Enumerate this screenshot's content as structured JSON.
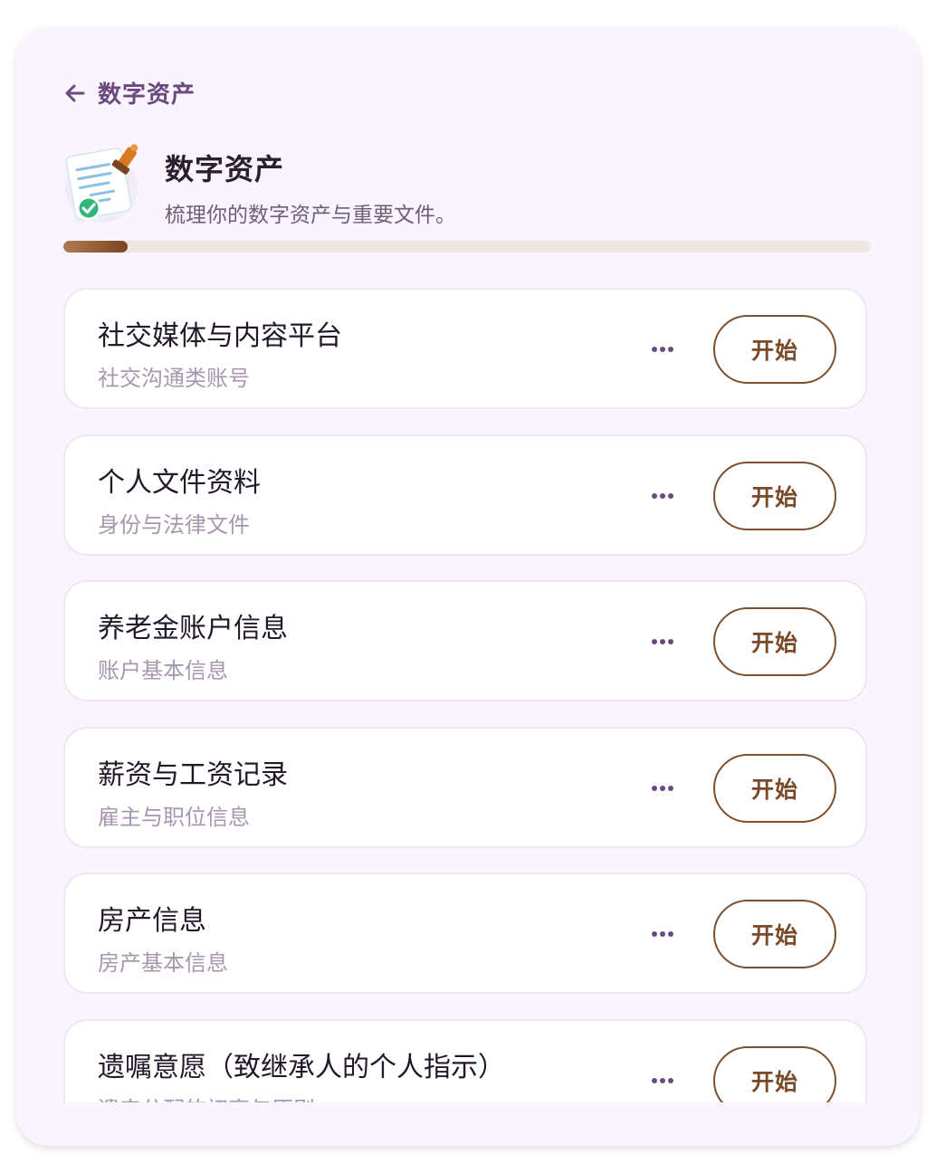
{
  "nav": {
    "back_label": "数字资产"
  },
  "header": {
    "title": "数字资产",
    "subtitle": "梳理你的数字资产与重要文件。"
  },
  "progress": {
    "fraction": 0.08
  },
  "colors": {
    "accent_brown": "#7e4f2f",
    "card_bg": "#f9f4fd",
    "title_purple": "#6a4a7d"
  },
  "items": [
    {
      "title": "社交媒体与内容平台",
      "subtitle": "社交沟通类账号",
      "action": "开始"
    },
    {
      "title": "个人文件资料",
      "subtitle": "身份与法律文件",
      "action": "开始"
    },
    {
      "title": "养老金账户信息",
      "subtitle": "账户基本信息",
      "action": "开始"
    },
    {
      "title": "薪资与工资记录",
      "subtitle": "雇主与职位信息",
      "action": "开始"
    },
    {
      "title": "房产信息",
      "subtitle": "房产基本信息",
      "action": "开始"
    },
    {
      "title": "遗嘱意愿（致继承人的个人指示）",
      "subtitle": "遗产分配的初衷与原则",
      "action": "开始"
    }
  ],
  "icons": {
    "back": "arrow-left-icon",
    "header": "document-stamp-icon",
    "more": "more-horizontal-icon"
  }
}
